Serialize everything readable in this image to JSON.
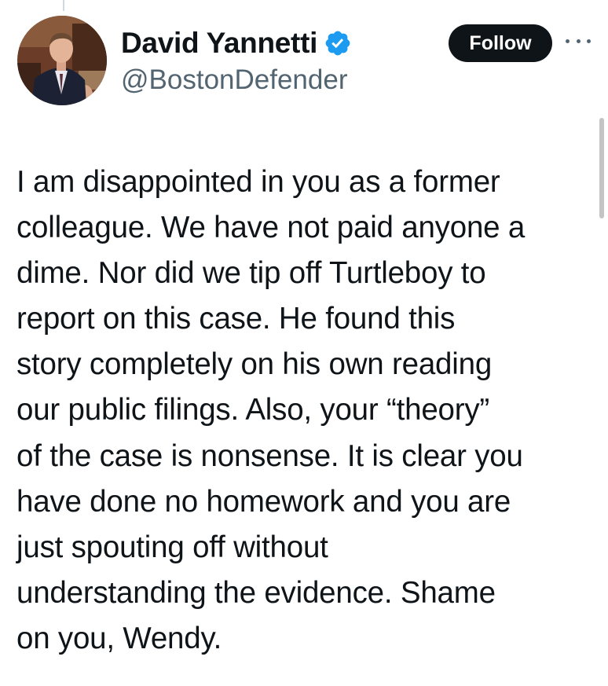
{
  "author": {
    "display_name": "David Yannetti",
    "handle": "@BostonDefender",
    "verified_icon": "verified-badge-icon",
    "avatar_icon": "profile-photo"
  },
  "actions": {
    "follow_label": "Follow",
    "more_icon": "more-options-icon"
  },
  "colors": {
    "text_primary": "#0f1419",
    "text_secondary": "#536471",
    "verified_blue": "#1d9bf0",
    "follow_bg": "#0f1419"
  },
  "tweet": {
    "text": "I am disappointed in you as a former\ncolleague.  We have not paid anyone a\ndime.  Nor did we tip off Turtleboy to\nreport on this case.  He found this\nstory completely on his own reading\nour public filings.  Also, your “theory”\nof the case is nonsense.  It is clear you\nhave done no homework and you are\njust spouting off without\nunderstanding the evidence.  Shame\non you, Wendy."
  }
}
